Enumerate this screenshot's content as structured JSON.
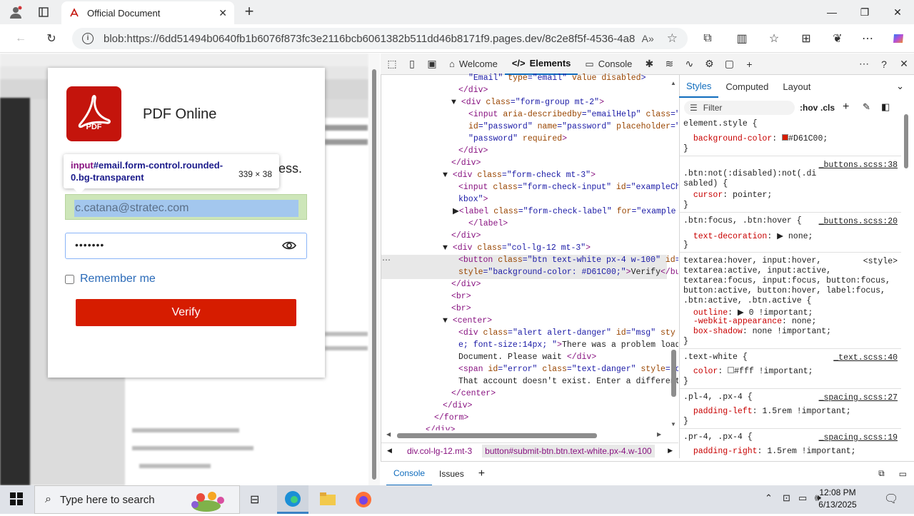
{
  "browser": {
    "tab_title": "Official Document",
    "url": "blob:https://6dd51494b0640fb1b6076f873fc3e2116bcb6061382b511dd46b8171f9.pages.dev/8c2e8f5f-4536-4a86-...",
    "accent": "#0f6cbd"
  },
  "login": {
    "brand": "PDF Online",
    "logo_text": "PDF",
    "lead_suffix": "ess.",
    "email_value": "c.catana@stratec.com",
    "password_mask": "•••••••",
    "remember_label": "Remember me",
    "verify_label": "Verify",
    "verify_color": "#D61C00"
  },
  "tooltip": {
    "tag": "input",
    "selector": "#email.form-control.rounded-0.bg-transparent",
    "dimensions": "339 × 38"
  },
  "devtools": {
    "tabs": [
      "Welcome",
      "Elements",
      "Console"
    ],
    "active_tab": "Elements",
    "styles_tabs": [
      "Styles",
      "Computed",
      "Layout"
    ],
    "filter_placeholder": "Filter",
    "hov": ":hov",
    "cls": ".cls",
    "breadcrumb": [
      "div.col-lg-12.mt-3",
      "button#submit-btn.btn.text-white.px-4.w-100"
    ],
    "drawer_tabs": [
      "Console",
      "Issues"
    ]
  },
  "taskbar": {
    "search_placeholder": "Type here to search",
    "time": "12:08 PM",
    "date": "6/13/2025"
  }
}
